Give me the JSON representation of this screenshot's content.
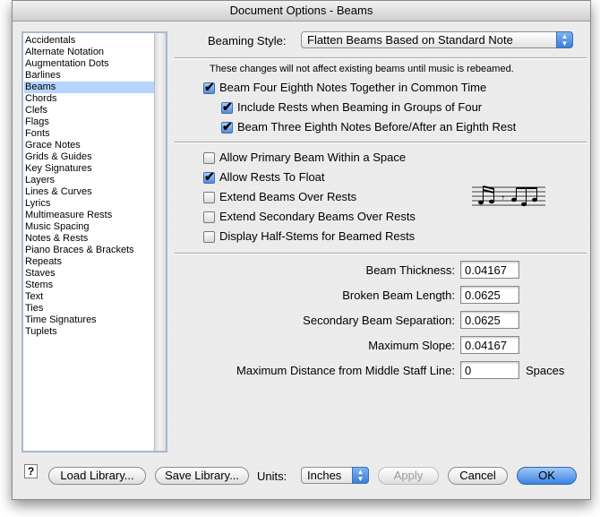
{
  "window": {
    "title": "Document Options - Beams"
  },
  "sidebar": {
    "items": [
      "Accidentals",
      "Alternate Notation",
      "Augmentation Dots",
      "Barlines",
      "Beams",
      "Chords",
      "Clefs",
      "Flags",
      "Fonts",
      "Grace Notes",
      "Grids & Guides",
      "Key Signatures",
      "Layers",
      "Lines & Curves",
      "Lyrics",
      "Multimeasure Rests",
      "Music Spacing",
      "Notes & Rests",
      "Piano Braces & Brackets",
      "Repeats",
      "Staves",
      "Stems",
      "Text",
      "Ties",
      "Time Signatures",
      "Tuplets"
    ],
    "selected_index": 4
  },
  "beaming_style": {
    "label": "Beaming Style:",
    "value": "Flatten Beams Based on Standard Note"
  },
  "notice": "These changes will not affect existing beams until music is rebeamed.",
  "group1": [
    {
      "label": "Beam Four Eighth Notes Together in Common Time",
      "checked": true
    },
    {
      "label": "Include Rests when Beaming in Groups of Four",
      "checked": true
    },
    {
      "label": "Beam Three Eighth Notes Before/After an Eighth Rest",
      "checked": true
    }
  ],
  "group2": [
    {
      "label": "Allow Primary Beam Within a Space",
      "checked": false
    },
    {
      "label": "Allow Rests To Float",
      "checked": true
    },
    {
      "label": "Extend Beams Over Rests",
      "checked": false
    },
    {
      "label": "Extend Secondary Beams Over Rests",
      "checked": false
    },
    {
      "label": "Display Half-Stems for Beamed Rests",
      "checked": false
    }
  ],
  "fields": [
    {
      "label": "Beam Thickness:",
      "value": "0.04167"
    },
    {
      "label": "Broken Beam Length:",
      "value": "0.0625"
    },
    {
      "label": "Secondary Beam Separation:",
      "value": "0.0625"
    },
    {
      "label": "Maximum Slope:",
      "value": "0.04167"
    },
    {
      "label": "Maximum Distance from Middle Staff Line:",
      "value": "0",
      "suffix": "Spaces"
    }
  ],
  "footer": {
    "help": "?",
    "load_library": "Load Library...",
    "save_library": "Save Library...",
    "units_label": "Units:",
    "units_value": "Inches",
    "apply": "Apply",
    "cancel": "Cancel",
    "ok": "OK"
  },
  "colors": {
    "selection": "#b5d5ff",
    "default_button": "#3b84e0",
    "checkbox_checked": "#4e8fe0"
  }
}
